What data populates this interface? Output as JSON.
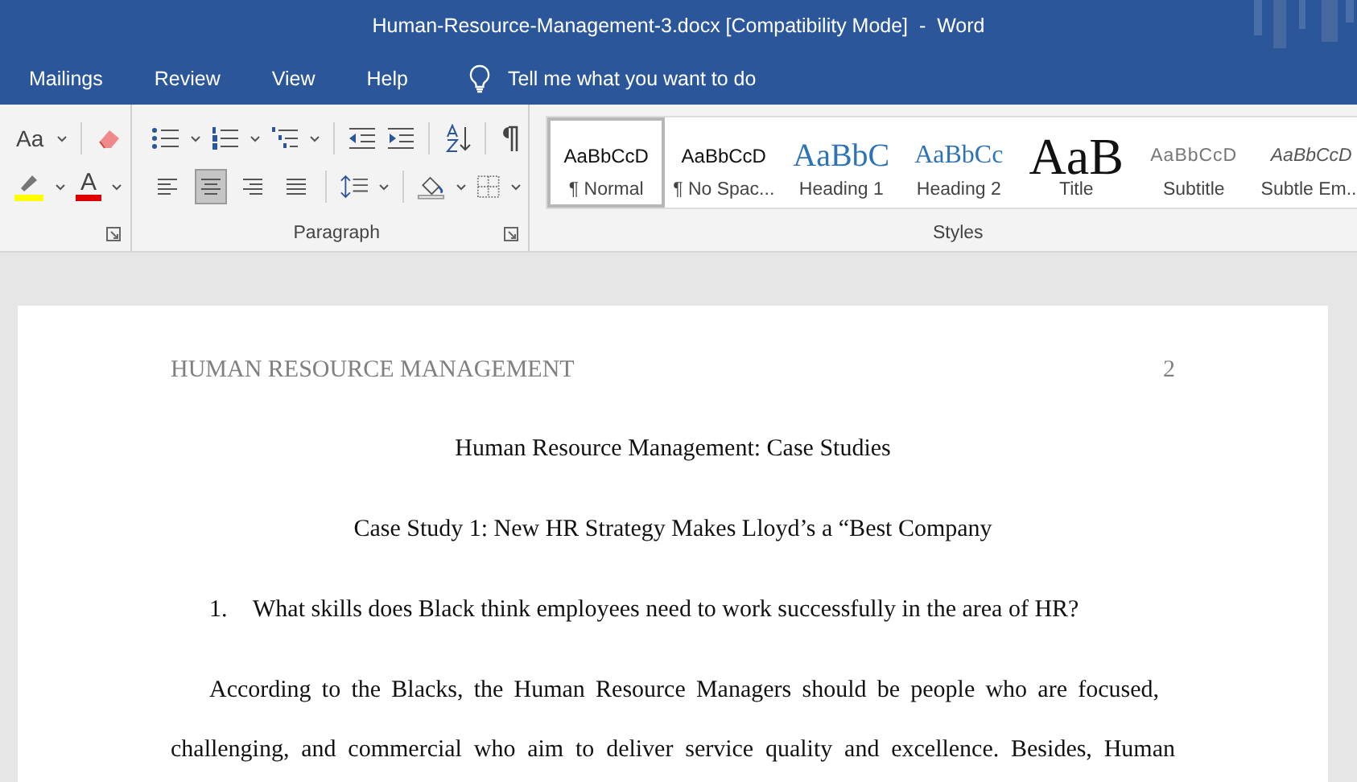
{
  "window": {
    "title": "Human-Resource-Management-3.docx [Compatibility Mode]  -  Word"
  },
  "menu_tabs": [
    {
      "label": "Mailings",
      "selected": false
    },
    {
      "label": "Review",
      "selected": false
    },
    {
      "label": "View",
      "selected": false
    },
    {
      "label": "Help",
      "selected": false
    }
  ],
  "tell_me": {
    "placeholder": "Tell me what you want to do"
  },
  "ribbon": {
    "font_group": {
      "change_case": "Aa",
      "font_color_letter": "A"
    },
    "paragraph_group": {
      "label": "Paragraph",
      "alignment": [
        {
          "kind": "left",
          "selected": false
        },
        {
          "kind": "center",
          "selected": true
        },
        {
          "kind": "right",
          "selected": false
        },
        {
          "kind": "justify",
          "selected": false
        }
      ]
    },
    "styles_group": {
      "label": "Styles",
      "styles": [
        {
          "kind": "normal",
          "preview": "AaBbCcD",
          "name": "¶ Normal",
          "selected": true
        },
        {
          "kind": "normal",
          "preview": "AaBbCcD",
          "name": "¶ No Spac...",
          "selected": false
        },
        {
          "kind": "heading1",
          "preview": "AaBbC",
          "name": "Heading 1",
          "selected": false
        },
        {
          "kind": "heading2",
          "preview": "AaBbCc",
          "name": "Heading 2",
          "selected": false
        },
        {
          "kind": "title",
          "preview": "AaB",
          "name": "Title",
          "selected": false
        },
        {
          "kind": "subtitle",
          "preview": "AaBbCcD",
          "name": "Subtitle",
          "selected": false
        },
        {
          "kind": "emphasis",
          "preview": "AaBbCcD",
          "name": "Subtle Em...",
          "selected": false
        }
      ]
    }
  },
  "document": {
    "header": {
      "title": "HUMAN RESOURCE MANAGEMENT",
      "page_number": "2"
    },
    "title": "Human Resource Management: Case Studies",
    "subtitle": "Case Study 1: New HR Strategy Makes Lloyd’s a “Best Company",
    "question": {
      "number": "1.",
      "text": "What skills does Black think employees need to work successfully in the area of HR?"
    },
    "paragraph_lines": [
      "According to the Blacks, the Human Resource Managers should be people who are focused,",
      "challenging, and commercial who aim to deliver service quality and excellence. Besides, Human"
    ]
  }
}
